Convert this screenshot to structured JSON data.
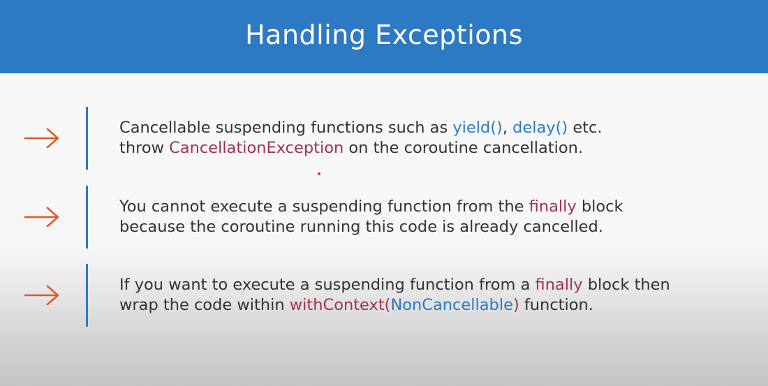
{
  "slide": {
    "title": "Handling Exceptions",
    "colors": {
      "header": "#2d7ac4",
      "arrow": "#e05a2a",
      "keyword_blue": "#2d7ac4",
      "keyword_red": "#a2324e",
      "body_text": "#333333"
    },
    "bullets": [
      {
        "icon": "right-arrow-icon",
        "line1": {
          "a": "Cancellable suspending functions such as ",
          "b": "yield()",
          "c": ", ",
          "d": "delay()",
          "e": " etc."
        },
        "line2": {
          "a": "throw ",
          "b": "CancellationException",
          "c": " on the coroutine cancellation."
        }
      },
      {
        "icon": "right-arrow-icon",
        "line1": {
          "a": "You cannot execute a suspending function from the ",
          "b": "finally",
          "c": " block"
        },
        "line2": {
          "a": "because the coroutine running this code is already cancelled."
        }
      },
      {
        "icon": "right-arrow-icon",
        "line1": {
          "a": "If you want to execute a suspending function from a ",
          "b": "finally",
          "c": " block then"
        },
        "line2": {
          "a": "wrap the code within ",
          "b": "withContext(",
          "c": "NonCancellable",
          "d": ")",
          "e": " function."
        }
      }
    ]
  }
}
